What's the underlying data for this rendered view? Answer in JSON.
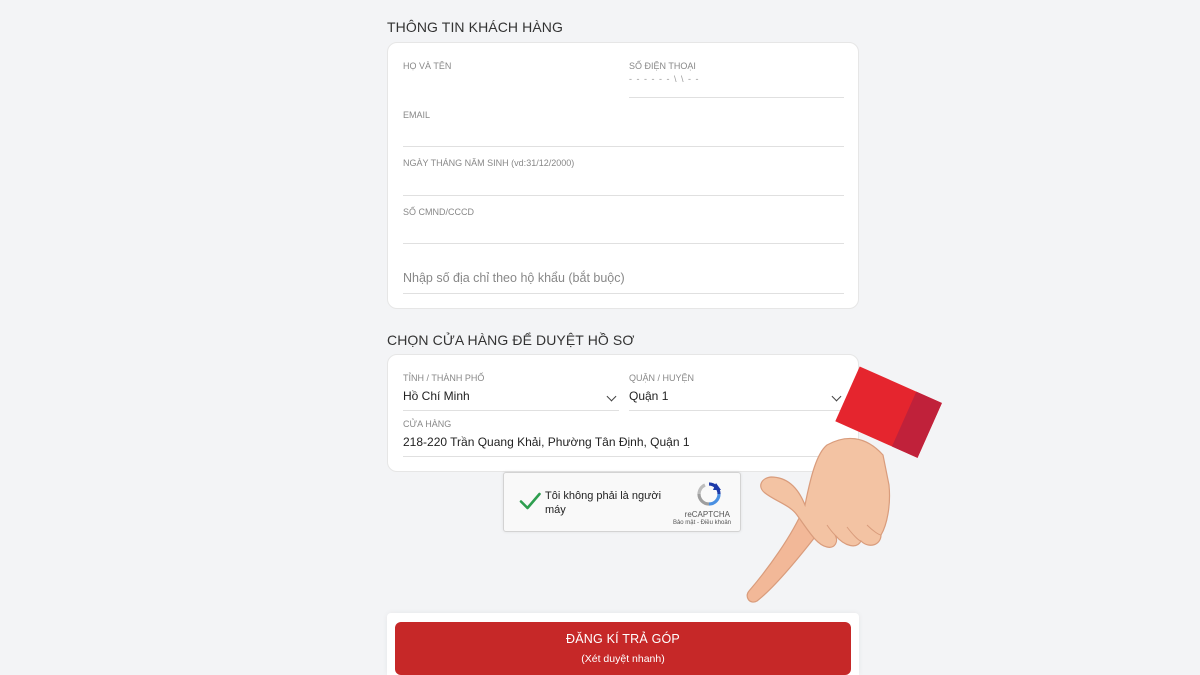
{
  "customer_section": {
    "title": "THÔNG TIN KHÁCH HÀNG",
    "full_name": {
      "label": "HỌ VÀ TÊN",
      "value": ""
    },
    "phone": {
      "label": "SỐ ĐIỆN THOẠI",
      "masked_value": "- - - - - - \\ \\ - -"
    },
    "email": {
      "label": "EMAIL",
      "value": ""
    },
    "dob": {
      "label": "NGÀY THÁNG NĂM SINH (vd:31/12/2000)",
      "value": ""
    },
    "id_number": {
      "label": "SỐ CMND/CCCD",
      "value": ""
    },
    "address": {
      "placeholder": "Nhập số địa chỉ theo hộ khẩu (bắt buộc)"
    }
  },
  "store_section": {
    "title": "CHỌN CỬA HÀNG ĐỂ DUYỆT HỒ SƠ",
    "province": {
      "label": "TỈNH / THÀNH PHỐ",
      "value": "Hồ Chí Minh"
    },
    "district": {
      "label": "QUẬN / HUYỆN",
      "value": "Quận 1"
    },
    "store": {
      "label": "CỬA HÀNG",
      "value": "218-220 Trần Quang Khải, Phường Tân Định, Quận 1"
    }
  },
  "captcha": {
    "label": "Tôi không phải là người máy",
    "brand": "reCAPTCHA",
    "privacy": "Bảo mật",
    "separator": " - ",
    "terms": "Điều khoản",
    "checked": true
  },
  "submit": {
    "label": "ĐĂNG KÍ TRẢ GÓP",
    "sublabel": "(Xét duyệt nhanh)"
  },
  "colors": {
    "primary": "#c62828",
    "check": "#2e9e4f",
    "cuff": "#e5252e"
  }
}
